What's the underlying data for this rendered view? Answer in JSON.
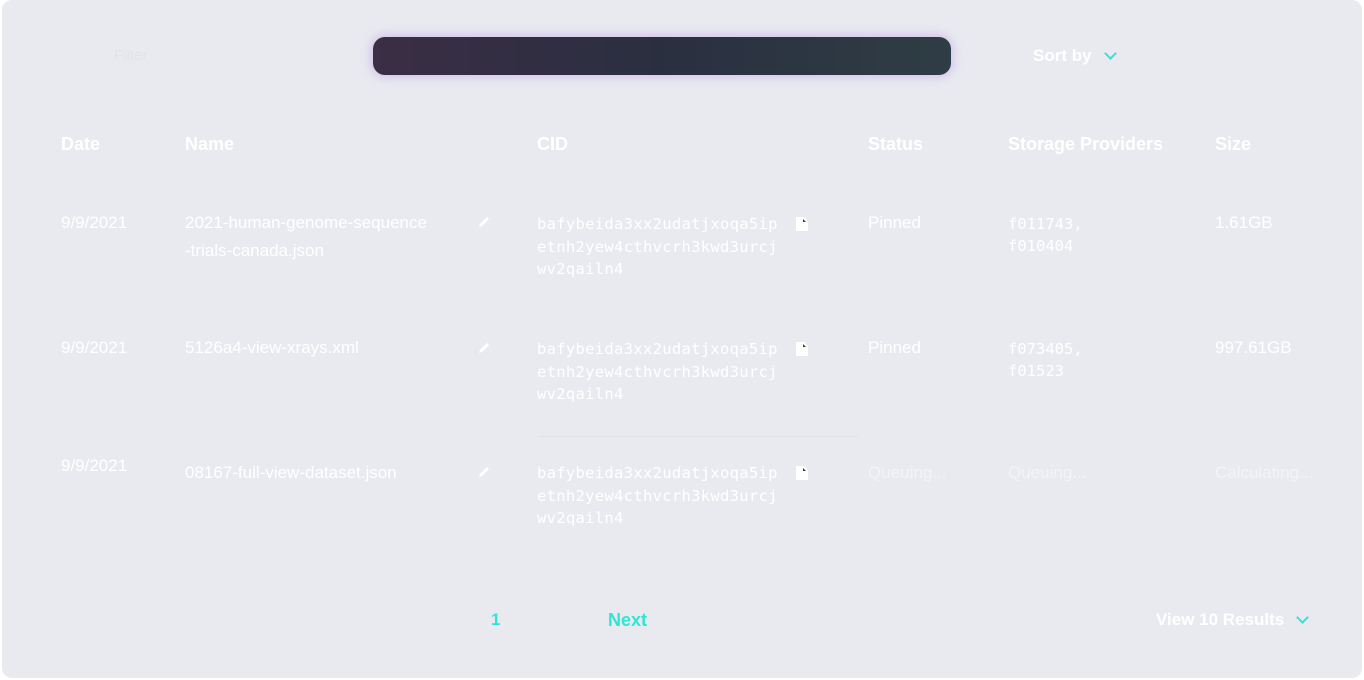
{
  "filter": {
    "label": "Filter"
  },
  "search": {
    "placeholder": ""
  },
  "sort": {
    "label": "Sort by"
  },
  "table": {
    "columns": [
      "Date",
      "Name",
      "CID",
      "Status",
      "Storage Providers",
      "Size"
    ],
    "rows": [
      {
        "date": "9/9/2021",
        "name_line1": "2021-human-genome-sequence",
        "name_line2": "-trials-canada.json",
        "cid": "bafybeida3xx2udatjxoqa5ipetnh2yew4cthvcrh3kwd3urcjwv2qailn4",
        "status": "Pinned",
        "providers_line1": "f011743,",
        "providers_line2": "f010404",
        "size": "1.61GB"
      },
      {
        "date": "9/9/2021",
        "name_line1": "5126a4-view-xrays.xml",
        "name_line2": "",
        "cid": "bafybeida3xx2udatjxoqa5ipetnh2yew4cthvcrh3kwd3urcjwv2qailn4",
        "status": "Pinned",
        "providers_line1": "f073405,",
        "providers_line2": "f01523",
        "size": "997.61GB"
      },
      {
        "date": "9/9/2021",
        "name_line1": "08167-full-view-dataset.json",
        "name_line2": "",
        "cid": "bafybeida3xx2udatjxoqa5ipetnh2yew4cthvcrh3kwd3urcjwv2qailn4",
        "status": "Queuing...",
        "providers_line1": "Queuing...",
        "providers_line2": "",
        "size": "Calculating..."
      }
    ]
  },
  "pagination": {
    "current_page": "1",
    "next_label": "Next"
  },
  "results": {
    "label": "View 10 Results"
  },
  "icons": {
    "edit": "pencil-icon",
    "copy": "copy-icon",
    "chevron": "chevron-down-icon"
  },
  "colors": {
    "accent": "#2ee6d6",
    "panel": "#e9eaf0",
    "search_bar": "#2a2f40"
  }
}
